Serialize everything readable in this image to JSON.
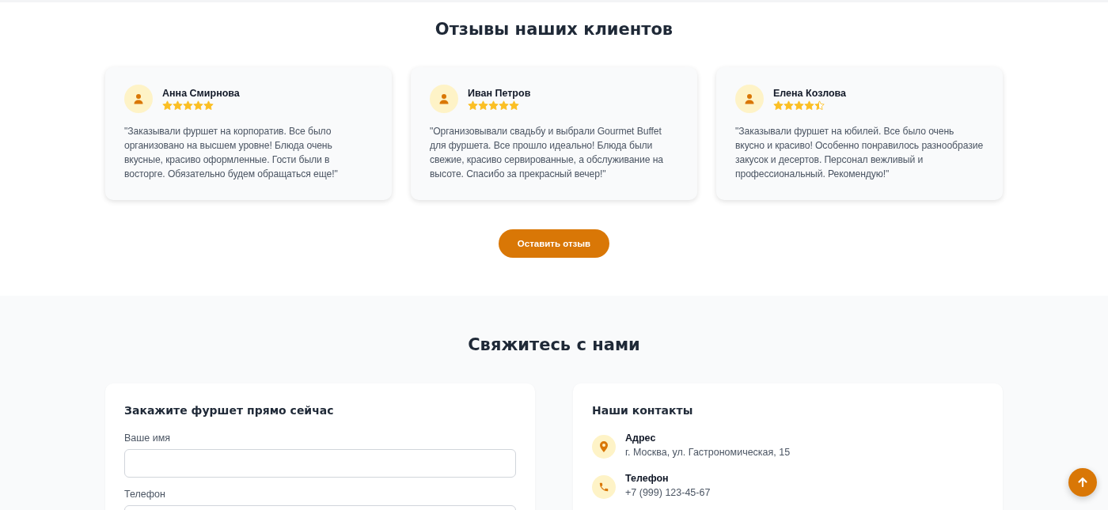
{
  "reviews_section": {
    "title": "Отзывы наших клиентов",
    "reviews": [
      {
        "name": "Анна Смирнова",
        "stars": 5,
        "text": "\"Заказывали фуршет на корпоратив. Все было организовано на высшем уровне! Блюда очень вкусные, красиво оформленные. Гости были в восторге. Обязательно будем обращаться еще!\""
      },
      {
        "name": "Иван Петров",
        "stars": 5,
        "text": "\"Организовывали свадьбу и выбрали Gourmet Buffet для фуршета. Все прошло идеально! Блюда были свежие, красиво сервированные, а обслуживание на высоте. Спасибо за прекрасный вечер!\""
      },
      {
        "name": "Елена Козлова",
        "stars": 4.5,
        "text": "\"Заказывали фуршет на юбилей. Все было очень вкусно и красиво! Особенно понравилось разнообразие закусок и десертов. Персонал вежливый и профессиональный. Рекомендую!\""
      }
    ],
    "button": "Оставить отзыв"
  },
  "contact_section": {
    "title": "Свяжитесь с нами",
    "form": {
      "title": "Закажите фуршет прямо сейчас",
      "fields": [
        {
          "label": "Ваше имя"
        },
        {
          "label": "Телефон"
        }
      ]
    },
    "contacts": {
      "title": "Наши контакты",
      "items": [
        {
          "kind": "address",
          "label": "Адрес",
          "value": "г. Москва, ул. Гастрономическая, 15"
        },
        {
          "kind": "phone",
          "label": "Телефон",
          "value": "+7 (999) 123-45-67"
        }
      ]
    }
  }
}
